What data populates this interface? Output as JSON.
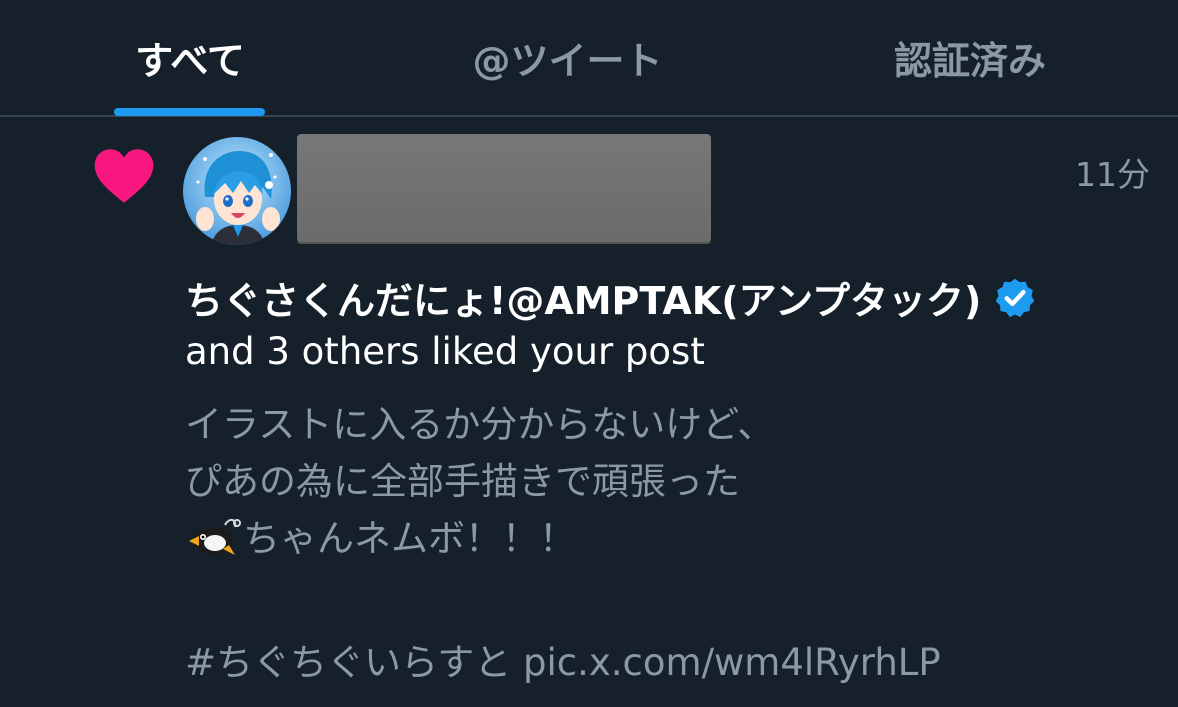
{
  "tabs": [
    {
      "label": "すべて",
      "active": true
    },
    {
      "label": "@ツイート",
      "active": false
    },
    {
      "label": "認証済み",
      "active": false
    }
  ],
  "notification": {
    "type_icon": "heart-icon",
    "type_color": "#f91880",
    "avatar_icon": "avatar-anime-character",
    "timestamp": "11分",
    "liker_name": "ちぐさくんだにょ!@AMPTAK(アンプタック)",
    "verified_icon": "verified-badge-icon",
    "verified_color": "#1d9bf0",
    "liked_text": "and 3 others liked your post",
    "post_lines": [
      "イラストに入るか分からないけど、",
      "ぴあの為に全部手描きで頑張った"
    ],
    "post_emoji_icon": "penguin-emoji-icon",
    "post_line3_text": "ちゃんネムボ！！！",
    "hashtag": "#ちぐちぐいらすと",
    "link": "pic.x.com/wm4lRyrhLP"
  },
  "colors": {
    "background": "#15202b",
    "accent": "#1d9bf0",
    "secondary_text": "#8b98a5",
    "divider": "#38444d"
  }
}
